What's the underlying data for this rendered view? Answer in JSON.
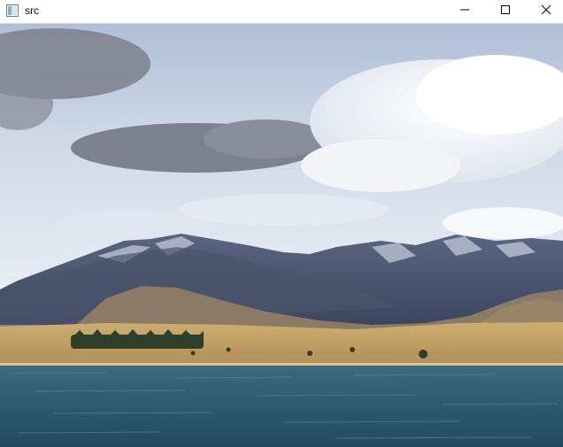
{
  "window": {
    "title": "src",
    "app_icon": "opencv-window-icon",
    "controls": {
      "minimize_icon": "minimize-icon",
      "maximize_icon": "maximize-icon",
      "close_icon": "close-icon"
    }
  },
  "image": {
    "subject": "lake-mountains-landscape",
    "colors": {
      "sky_top": "#b9c8e0",
      "sky_bottom": "#e6ecf3",
      "mountain_dark": "#4a5570",
      "hill_brown": "#8a7a66",
      "field_gold": "#c9a86a",
      "lake": "#2e5b73"
    }
  }
}
